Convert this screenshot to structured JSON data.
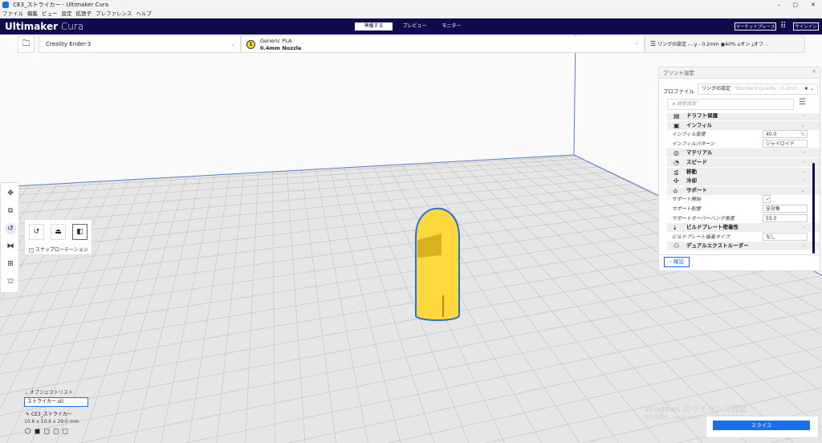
{
  "window": {
    "title": "CE3_ストライカー - Ultimaker Cura",
    "min": "–",
    "max": "▢",
    "close": "✕"
  },
  "menu": [
    "ファイル",
    "編集",
    "ビュー",
    "設定",
    "拡張子",
    "プレファレンス",
    "ヘルプ"
  ],
  "header": {
    "brand_bold": "Ultimaker",
    "brand_light": " Cura",
    "tabs": [
      "準備する",
      "プレビュー",
      "モニター"
    ],
    "marketplace": "マーケットプレース",
    "signin": "サインイン"
  },
  "toolbar": {
    "printer": "Creality Ender-3",
    "material": "Generic PLA",
    "nozzle": "0.4mm Nozzle",
    "extruder_no": "1",
    "profile": "リングの設定 -...y - 0.2mm",
    "infill": "40%",
    "support": "オン",
    "adhesion": "オフ"
  },
  "print_settings": {
    "title": "プリント設定",
    "close": "×",
    "profile_label": "プロファイル",
    "profile_name": "リングの設定",
    "profile_desc": " - Standard Quality - 0.2mm",
    "search_placeholder": "検索設定",
    "rows": [
      {
        "type": "cat",
        "label": "ドラフト保護",
        "icon": "shield"
      },
      {
        "type": "cat",
        "label": "インフィル",
        "icon": "infill"
      },
      {
        "type": "sub",
        "label": "インフィル密度",
        "value": "40.0",
        "unit": "%"
      },
      {
        "type": "sub",
        "label": "インフィルパターン",
        "value": "ジャイロイド"
      },
      {
        "type": "cat",
        "label": "マテリアル",
        "icon": "material"
      },
      {
        "type": "cat",
        "label": "スピード",
        "icon": "speed"
      },
      {
        "type": "cat",
        "label": "移動",
        "icon": "travel"
      },
      {
        "type": "cat",
        "label": "冷却",
        "icon": "fan"
      },
      {
        "type": "cat",
        "label": "サポート",
        "icon": "support"
      },
      {
        "type": "sub",
        "label": "サポート開始",
        "value": "✓"
      },
      {
        "type": "sub",
        "label": "サポート配置",
        "value": "全対象"
      },
      {
        "type": "sub",
        "label": "サポートオーバーハング角度",
        "value": "55.0"
      },
      {
        "type": "cat",
        "label": "ビルドプレート密着性",
        "icon": "adhesion"
      },
      {
        "type": "sub",
        "label": "ビルドプレート接着タイプ",
        "value": "なし"
      },
      {
        "type": "cat",
        "label": "デュアルエクストルーダー",
        "icon": "dual"
      }
    ],
    "confirm": "‹ 確認"
  },
  "rotate_panel": {
    "snap": "スナップローテーション"
  },
  "object_list": {
    "title": "オブジェクトリスト",
    "file": "ストライカー.stl",
    "name": "CE3_ストライカー",
    "dims": "10.6 x 10.6 x 29.0 mm"
  },
  "watermark": {
    "title": "Windows のライセンス認証",
    "sub": "設定を開き、Windows のライセンス認証を行ってください。"
  },
  "slice": "スライス",
  "colors": {
    "header": "#0f0b4d",
    "accent": "#196ef0",
    "model": "#ffd83d"
  }
}
